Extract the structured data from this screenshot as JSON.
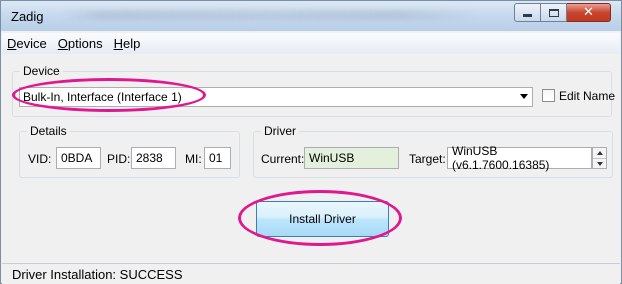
{
  "window": {
    "title": "Zadig",
    "caption_buttons": {
      "minimize": "minimize-icon",
      "maximize": "maximize-icon",
      "close": "close-icon"
    }
  },
  "menu": {
    "items": [
      {
        "access_key": "D",
        "rest": "evice"
      },
      {
        "access_key": "O",
        "rest": "ptions"
      },
      {
        "access_key": "H",
        "rest": "elp"
      }
    ]
  },
  "device": {
    "group_label": "Device",
    "selected": "Bulk-In, Interface (Interface 1)",
    "edit_name_label": "Edit Name",
    "edit_name_checked": false
  },
  "details": {
    "group_label": "Details",
    "vid_label": "VID:",
    "vid_value": "0BDA",
    "pid_label": "PID:",
    "pid_value": "2838",
    "mi_label": "MI:",
    "mi_value": "01"
  },
  "driver": {
    "group_label": "Driver",
    "current_label": "Current:",
    "current_value": "WinUSB",
    "target_label": "Target:",
    "target_value": "WinUSB (v6.1.7600.16385)"
  },
  "actions": {
    "install_label": "Install Driver"
  },
  "status": {
    "text": "Driver Installation: SUCCESS"
  },
  "colors": {
    "highlight": "#e0188f",
    "current_bg": "#e2f0dc",
    "button_border": "#3c7fb1"
  }
}
